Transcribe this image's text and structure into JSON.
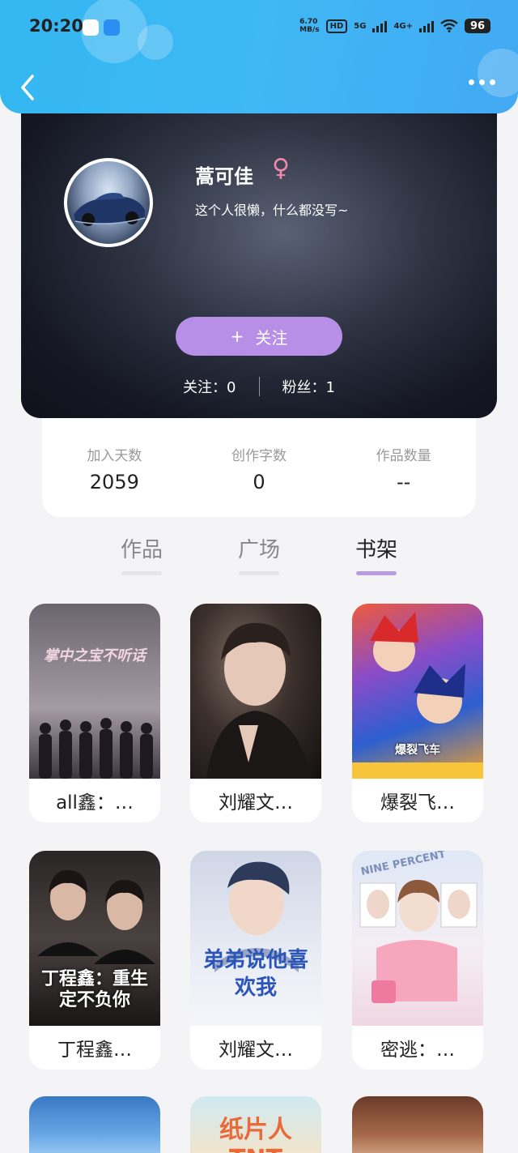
{
  "status_bar": {
    "time": "20:20",
    "net_speed_value": "6.70",
    "net_speed_unit": "MB/s",
    "hd_label": "HD",
    "sim1": "5G",
    "sim2": "4G+",
    "battery": "96"
  },
  "profile": {
    "name": "蒿可佳",
    "gender_symbol": "♀",
    "bio": "这个人很懒，什么都没写~",
    "follow_plus": "+",
    "follow_label": "关注",
    "following": "关注：0",
    "followers": "粉丝：1"
  },
  "stats": [
    {
      "label": "加入天数",
      "value": "2059"
    },
    {
      "label": "创作字数",
      "value": "0"
    },
    {
      "label": "作品数量",
      "value": "--"
    }
  ],
  "tabs": [
    {
      "label": "作品",
      "active": false
    },
    {
      "label": "广场",
      "active": false
    },
    {
      "label": "书架",
      "active": true
    }
  ],
  "books": [
    {
      "title": "all鑫：…",
      "cover_text": "掌中之宝不听话"
    },
    {
      "title": "刘耀文…",
      "cover_text": ""
    },
    {
      "title": "爆裂飞…",
      "cover_text": "爆裂飞车"
    },
    {
      "title": "丁程鑫…",
      "cover_text": "丁程鑫：重生定不负你"
    },
    {
      "title": "刘耀文…",
      "cover_text": "弟弟说他喜欢我"
    },
    {
      "title": "密逃：…",
      "cover_text": "NINE PERCENT"
    }
  ],
  "partial_books": [
    {
      "cover_text": ""
    },
    {
      "cover_text": "纸片人 TNT"
    },
    {
      "cover_text": ""
    }
  ],
  "colors": {
    "top_bar": "#3fb8f4",
    "follow_button": "#b88fe6",
    "active_tab_indicator": "#b89be0",
    "gender": "#f18aa8"
  }
}
